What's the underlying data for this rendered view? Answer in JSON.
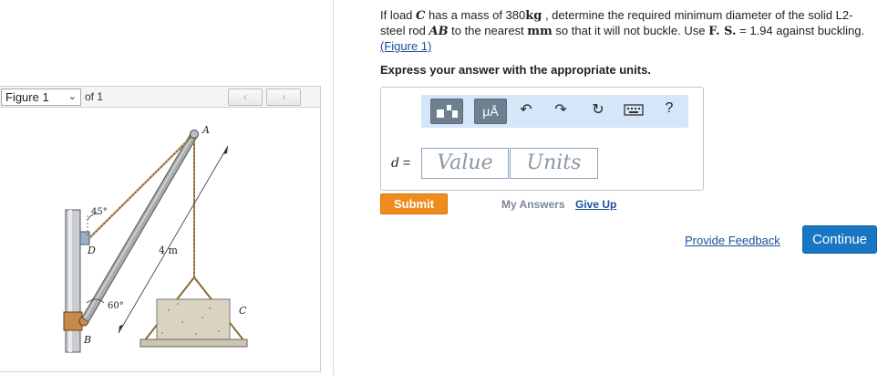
{
  "figure_panel": {
    "select_value": "Figure 1",
    "of_label": "of 1",
    "prev_icon": "chevron-left-icon",
    "next_icon": "chevron-right-icon",
    "labels": {
      "A": "A",
      "B": "B",
      "C": "C",
      "D": "D",
      "angle_top": "45°",
      "angle_bottom": "60°",
      "length": "4 m"
    }
  },
  "question": {
    "t1": "If load ",
    "var_C": "C",
    "t2": " has a mass of 380",
    "unit_kg": "kg",
    "t3": " , determine the required minimum diameter of the solid L2-steel rod ",
    "var_AB": "AB",
    "t4": " to the nearest ",
    "unit_mm": "mm",
    "t5": " so that it will not buckle. Use ",
    "fs": "F. S.",
    "t6": " = 1.94 against buckling.",
    "figure_link": "(Figure 1)",
    "instruction": "Express your answer with the appropriate units."
  },
  "answer": {
    "variable": "d",
    "equals": " =",
    "value_placeholder": "Value",
    "units_placeholder": "Units",
    "toolbar": {
      "units_label": "μÅ",
      "icons": [
        "templates-icon",
        "units-icon",
        "undo-icon",
        "redo-icon",
        "reset-icon",
        "keyboard-icon",
        "help-icon"
      ],
      "help": "?"
    }
  },
  "actions": {
    "submit": "Submit",
    "my_answers": "My Answers",
    "give_up": "Give Up",
    "feedback": "Provide Feedback",
    "continue": "Continue"
  },
  "colors": {
    "submit": "#f08c1d",
    "continue": "#1976c3",
    "toolbar_bg": "#d4e6f8",
    "link": "#1a4f9c"
  }
}
